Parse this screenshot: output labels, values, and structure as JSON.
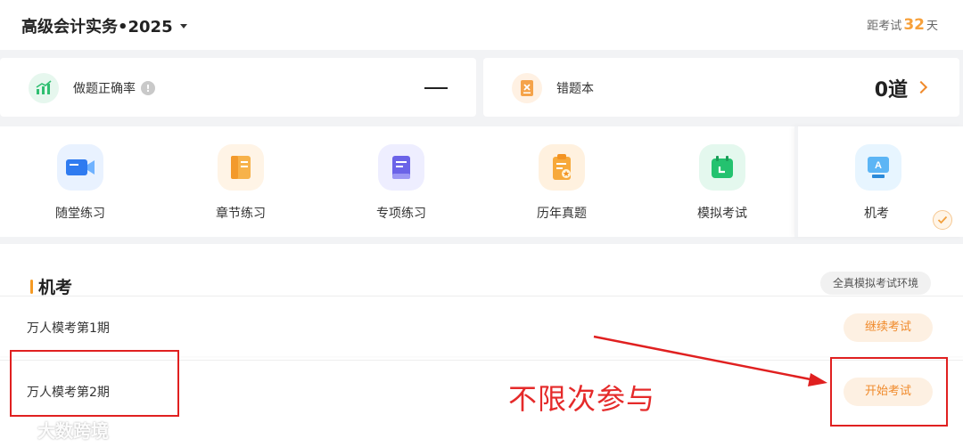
{
  "header": {
    "course_title": "高级会计实务•2025",
    "countdown_prefix": "距考试",
    "countdown_days": "32",
    "countdown_suffix": "天"
  },
  "stats": {
    "accuracy_label": "做题正确率",
    "accuracy_info": "!",
    "wrong_book_label": "错题本",
    "wrong_book_value": "0道"
  },
  "tools": [
    {
      "label": "随堂练习",
      "icon": "video-icon"
    },
    {
      "label": "章节练习",
      "icon": "book-icon"
    },
    {
      "label": "专项练习",
      "icon": "notebook-icon"
    },
    {
      "label": "历年真题",
      "icon": "clipboard-star-icon"
    },
    {
      "label": "模拟考试",
      "icon": "calendar-icon"
    },
    {
      "label": "机考",
      "icon": "computer-icon",
      "selected": true
    }
  ],
  "section": {
    "title": "机考",
    "env_tag": "全真模拟考试环境",
    "exams": [
      {
        "name": "万人模考第1期",
        "action": "继续考试"
      },
      {
        "name": "万人模考第2期",
        "action": "开始考试"
      }
    ]
  },
  "annotation": {
    "text": "不限次参与"
  },
  "watermark": {
    "text": "大数跨境"
  },
  "colors": {
    "accent": "#f08a2b",
    "days": "#f7a03a",
    "annotation_red": "#e02020"
  }
}
